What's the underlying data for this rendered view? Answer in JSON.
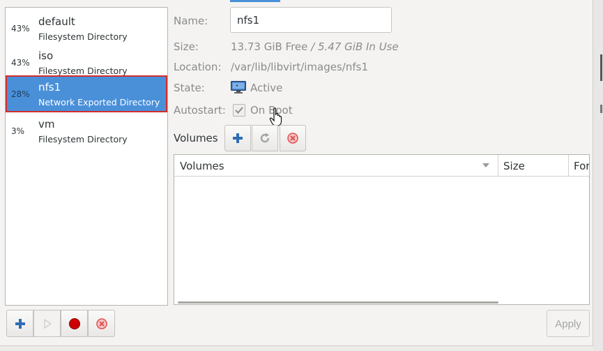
{
  "pools": [
    {
      "percent": "43%",
      "name": "default",
      "type": "Filesystem Directory",
      "selected": false
    },
    {
      "percent": "43%",
      "name": "iso",
      "type": "Filesystem Directory",
      "selected": false
    },
    {
      "percent": "28%",
      "name": "nfs1",
      "type": "Network Exported Directory",
      "selected": true
    },
    {
      "percent": "3%",
      "name": "vm",
      "type": "Filesystem Directory",
      "selected": false
    }
  ],
  "details": {
    "name_label": "Name:",
    "name_value": "nfs1",
    "size_label": "Size:",
    "size_free": "13.73 GiB Free",
    "size_sep": " / ",
    "size_used": "5.47 GiB In Use",
    "location_label": "Location:",
    "location_value": "/var/lib/libvirt/images/nfs1",
    "state_label": "State:",
    "state_value": "Active",
    "autostart_label": "Autostart:",
    "autostart_value": "On Boot",
    "autostart_checked": true
  },
  "volumes": {
    "section_label": "Volumes",
    "columns": [
      "Volumes",
      "Size",
      "For"
    ],
    "rows": []
  },
  "toolbar": {
    "apply_label": "Apply"
  },
  "colors": {
    "selection": "#4a90d9",
    "selection_outline": "#d12d2d",
    "add_icon": "#2f6db5",
    "stop_icon": "#cc0000",
    "delete_icon": "#e05050"
  },
  "icons": {
    "add_volume": "plus-icon",
    "refresh_volumes": "refresh-icon",
    "delete_volume": "delete-icon",
    "add_pool": "plus-icon",
    "start_pool": "play-icon",
    "stop_pool": "stop-icon",
    "delete_pool": "delete-icon",
    "state": "monitor-icon"
  }
}
